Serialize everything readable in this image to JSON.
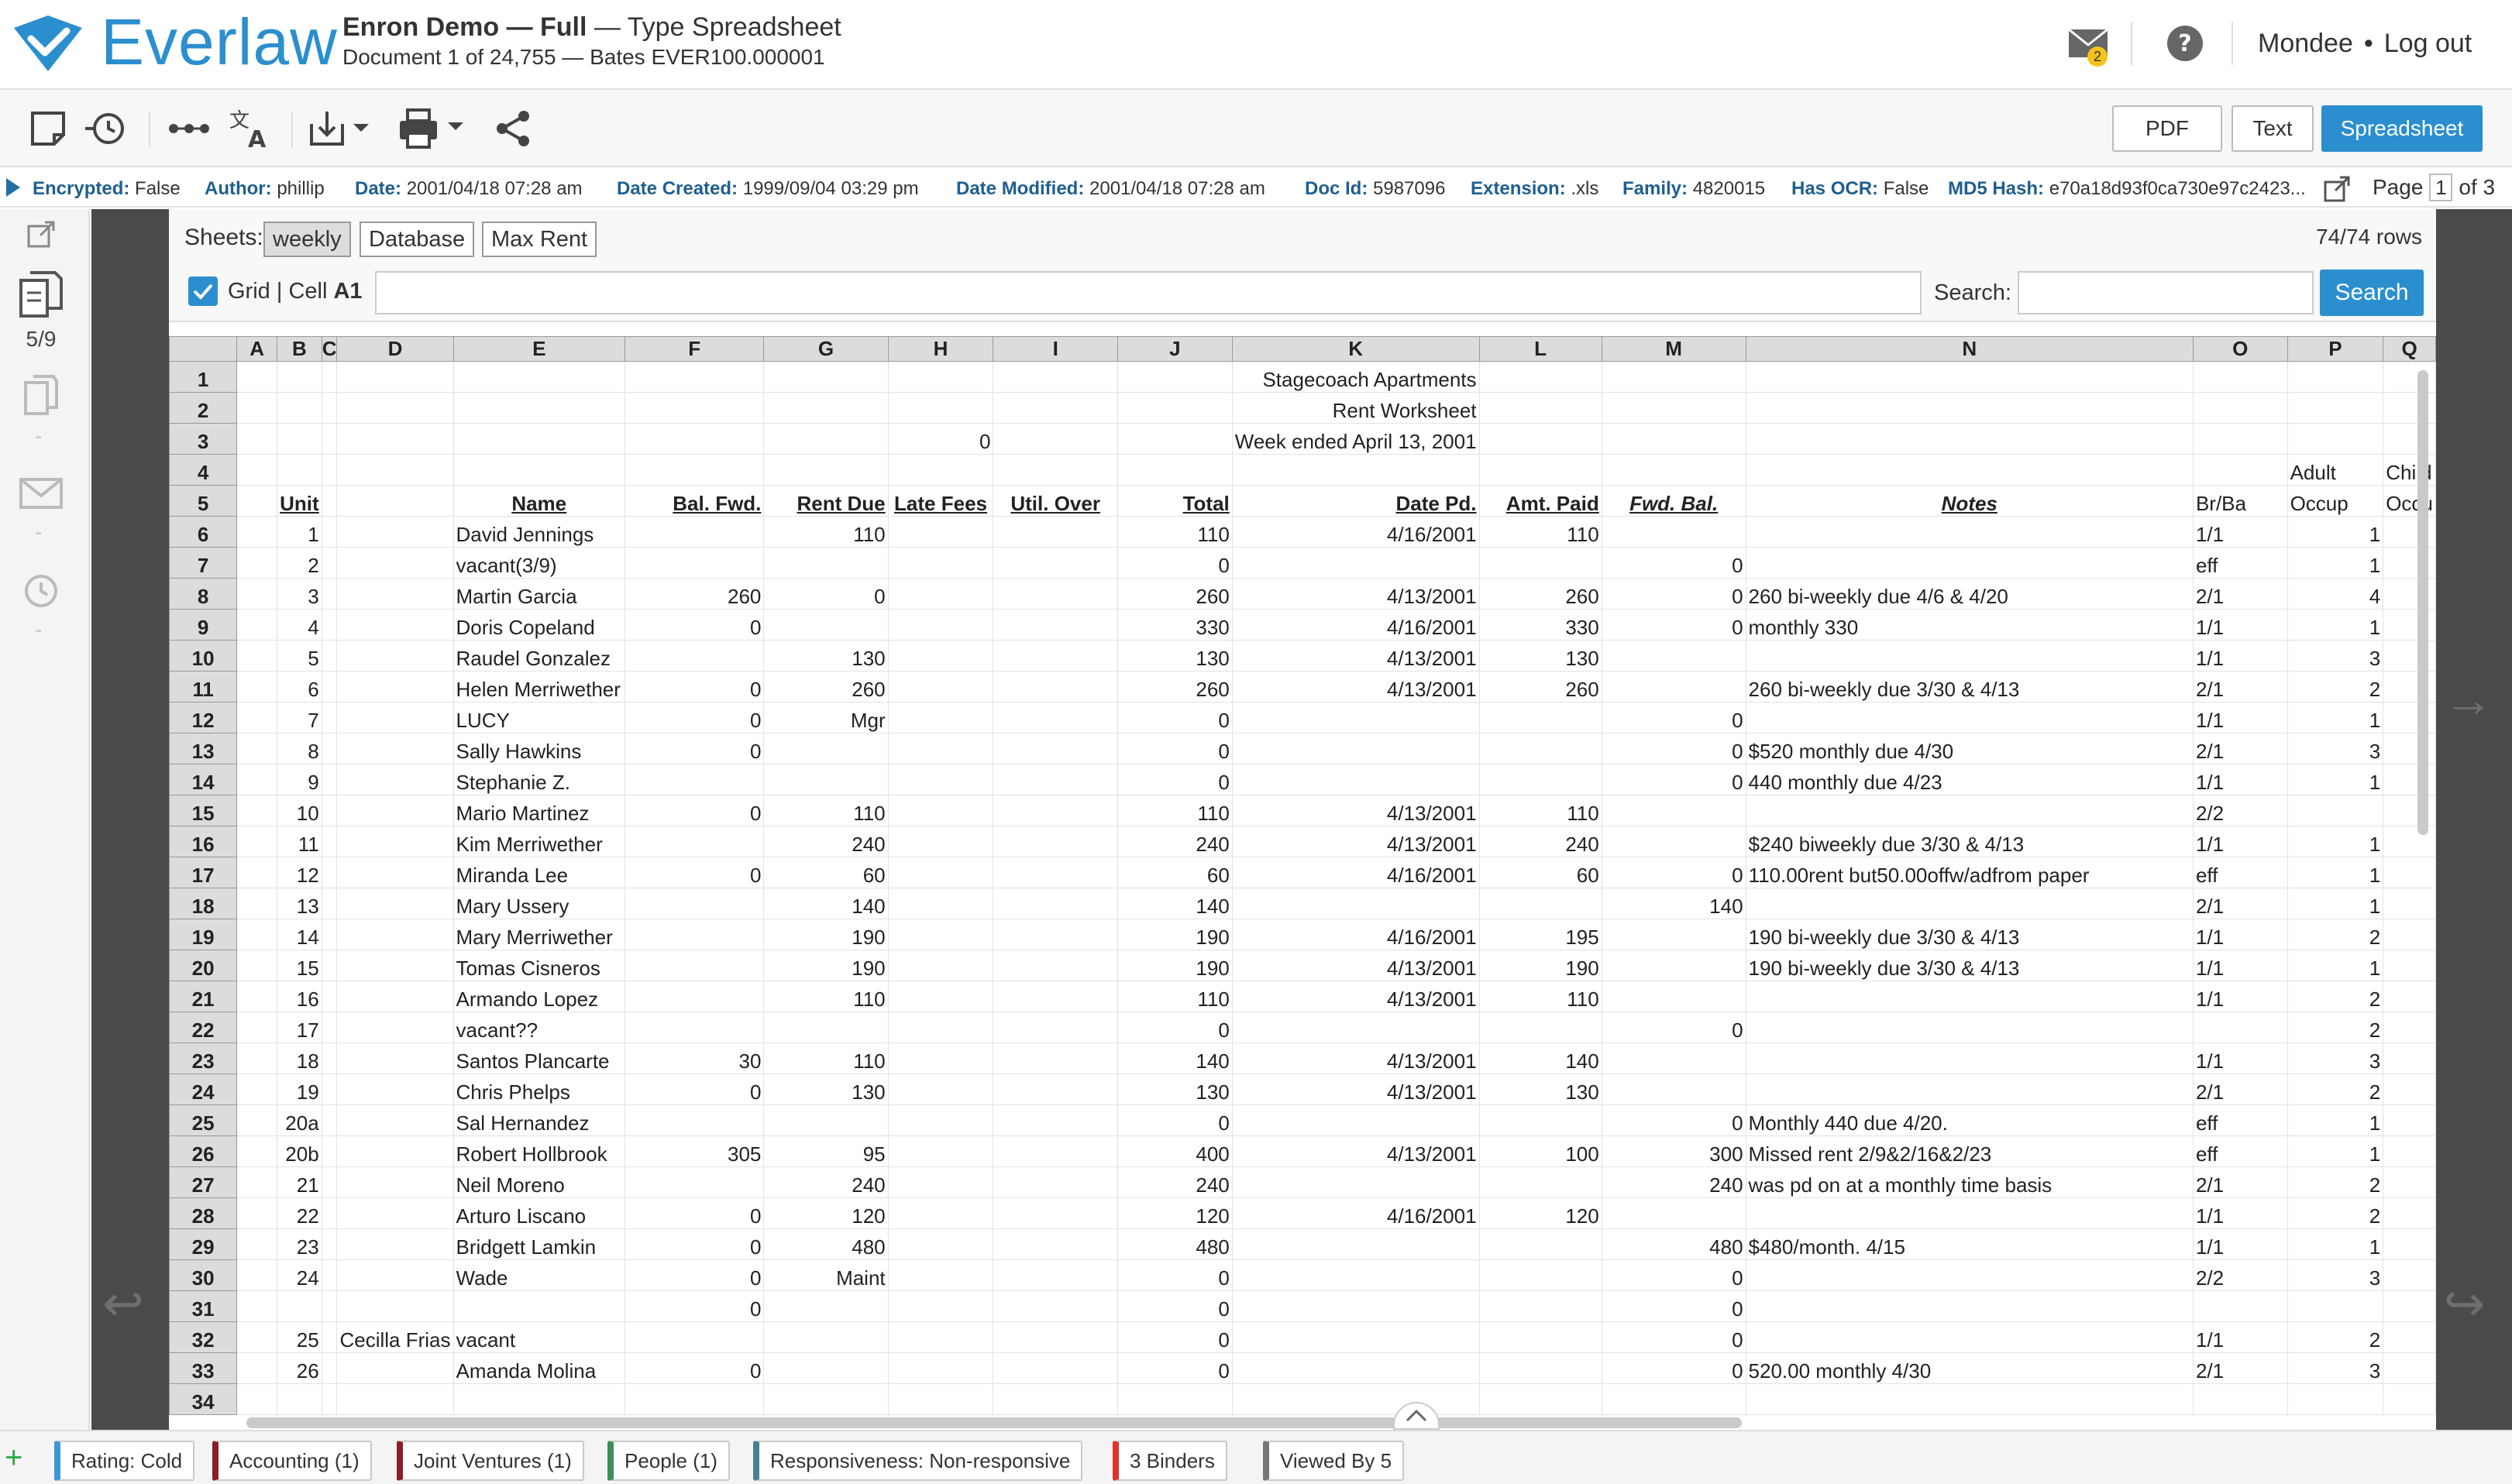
{
  "app": {
    "brand": "Everlaw",
    "project_name": "Enron Demo — Full",
    "type_text": "— Type Spreadsheet",
    "subtitle": "Document 1 of 24,755 — Bates EVER100.000001",
    "mail_badge": "2",
    "user": "Mondee",
    "bullet": "•",
    "logout": "Log out"
  },
  "toolbar": {
    "icons": [
      "note-icon",
      "history-icon",
      "more-icon",
      "translate-icon",
      "download-icon",
      "print-icon",
      "share-icon"
    ],
    "views": {
      "pdf": "PDF",
      "text": "Text",
      "spreadsheet": "Spreadsheet"
    }
  },
  "metadata": [
    {
      "k": "Encrypted:",
      "v": "False"
    },
    {
      "k": "Author:",
      "v": "phillip"
    },
    {
      "k": "Date:",
      "v": "2001/04/18 07:28 am"
    },
    {
      "k": "Date Created:",
      "v": "1999/09/04 03:29 pm"
    },
    {
      "k": "Date Modified:",
      "v": "2001/04/18 07:28 am"
    },
    {
      "k": "Doc Id:",
      "v": "5987096"
    },
    {
      "k": "Extension:",
      "v": ".xls"
    },
    {
      "k": "Family:",
      "v": "4820015"
    },
    {
      "k": "Has OCR:",
      "v": "False"
    },
    {
      "k": "MD5 Hash:",
      "v": "e70a18d93f0ca730e97c2423..."
    }
  ],
  "pager": {
    "label": "Page",
    "current": "1",
    "of": "of 3"
  },
  "rail": {
    "count": "5/9"
  },
  "sheets": {
    "label": "Sheets:",
    "tabs": [
      "weekly",
      "Database",
      "Max Rent"
    ],
    "active": "weekly",
    "row_count": "74/74 rows",
    "grid_label": "Grid",
    "cell_prefix": "Cell",
    "cell_ref": "A1",
    "search_label": "Search:",
    "search_button": "Search"
  },
  "columns": [
    "A",
    "B",
    "C",
    "D",
    "E",
    "F",
    "G",
    "H",
    "I",
    "J",
    "K",
    "L",
    "M",
    "N",
    "O",
    "P",
    "Q"
  ],
  "rows": [
    {
      "n": "1",
      "c": {
        "K": "Stagecoach Apartments"
      }
    },
    {
      "n": "2",
      "c": {
        "K": "Rent Worksheet"
      }
    },
    {
      "n": "3",
      "c": {
        "H": "0",
        "K": "Week ended April 13, 2001"
      }
    },
    {
      "n": "4",
      "c": {
        "P": "Adult",
        "Q": "Child"
      }
    },
    {
      "n": "5",
      "c": {
        "B": "Unit",
        "E": "Name",
        "F": "Bal. Fwd.",
        "G": "Rent Due",
        "H": "Late Fees",
        "I": "Util. Over",
        "J": "Total",
        "K": "Date Pd.",
        "L": "Amt. Paid",
        "M": "Fwd. Bal.",
        "N": "Notes",
        "O": "Br/Ba",
        "P": "Occup",
        "Q": "Occu"
      }
    },
    {
      "n": "6",
      "c": {
        "B": "1",
        "E": "David Jennings",
        "G": "110",
        "J": "110",
        "K": "4/16/2001",
        "L": "110",
        "O": "1/1",
        "P": "1"
      }
    },
    {
      "n": "7",
      "c": {
        "B": "2",
        "E": "vacant(3/9)",
        "J": "0",
        "M": "0",
        "O": "eff",
        "P": "1"
      }
    },
    {
      "n": "8",
      "c": {
        "B": "3",
        "E": "Martin Garcia",
        "F": "260",
        "G": "0",
        "J": "260",
        "K": "4/13/2001",
        "L": "260",
        "M": "0",
        "N": "260 bi-weekly due 4/6 & 4/20",
        "O": "2/1",
        "P": "4"
      }
    },
    {
      "n": "9",
      "c": {
        "B": "4",
        "E": "Doris Copeland",
        "F": "0",
        "J": "330",
        "K": "4/16/2001",
        "L": "330",
        "M": "0",
        "N": "monthly 330",
        "O": "1/1",
        "P": "1"
      }
    },
    {
      "n": "10",
      "c": {
        "B": "5",
        "E": "Raudel Gonzalez",
        "G": "130",
        "J": "130",
        "K": "4/13/2001",
        "L": "130",
        "O": "1/1",
        "P": "3"
      }
    },
    {
      "n": "11",
      "c": {
        "B": "6",
        "E": "Helen Merriwether",
        "F": "0",
        "G": "260",
        "J": "260",
        "K": "4/13/2001",
        "L": "260",
        "N": "260 bi-weekly due 3/30 & 4/13",
        "O": "2/1",
        "P": "2"
      }
    },
    {
      "n": "12",
      "c": {
        "B": "7",
        "E": "LUCY",
        "F": "0",
        "G": "Mgr",
        "J": "0",
        "M": "0",
        "O": "1/1",
        "P": "1"
      }
    },
    {
      "n": "13",
      "c": {
        "B": "8",
        "E": "Sally Hawkins",
        "F": "0",
        "J": "0",
        "M": "0",
        "N": "$520 monthly due 4/30",
        "O": "2/1",
        "P": "3"
      }
    },
    {
      "n": "14",
      "c": {
        "B": "9",
        "E": "Stephanie Z.",
        "J": "0",
        "M": "0",
        "N": "440 monthly due 4/23",
        "O": "1/1",
        "P": "1"
      }
    },
    {
      "n": "15",
      "c": {
        "B": "10",
        "E": "Mario Martinez",
        "F": "0",
        "G": "110",
        "J": "110",
        "K": "4/13/2001",
        "L": "110",
        "O": "2/2"
      }
    },
    {
      "n": "16",
      "c": {
        "B": "11",
        "E": "Kim Merriwether",
        "G": "240",
        "J": "240",
        "K": "4/13/2001",
        "L": "240",
        "N": "$240 biweekly due 3/30 & 4/13",
        "O": "1/1",
        "P": "1"
      }
    },
    {
      "n": "17",
      "c": {
        "B": "12",
        "E": "Miranda Lee",
        "F": "0",
        "G": "60",
        "J": "60",
        "K": "4/16/2001",
        "L": "60",
        "M": "0",
        "N": "110.00rent but50.00offw/adfrom paper",
        "O": "eff",
        "P": "1"
      }
    },
    {
      "n": "18",
      "c": {
        "B": "13",
        "E": "Mary Ussery",
        "G": "140",
        "J": "140",
        "M": "140",
        "O": "2/1",
        "P": "1"
      }
    },
    {
      "n": "19",
      "c": {
        "B": "14",
        "E": "Mary Merriwether",
        "G": "190",
        "J": "190",
        "K": "4/16/2001",
        "L": "195",
        "N": "190 bi-weekly due  3/30 & 4/13",
        "O": "1/1",
        "P": "2"
      }
    },
    {
      "n": "20",
      "c": {
        "B": "15",
        "E": "Tomas Cisneros",
        "G": "190",
        "J": "190",
        "K": "4/13/2001",
        "L": "190",
        "N": "190 bi-weekly due  3/30 & 4/13",
        "O": "1/1",
        "P": "1"
      }
    },
    {
      "n": "21",
      "c": {
        "B": "16",
        "E": "Armando Lopez",
        "G": "110",
        "J": "110",
        "K": "4/13/2001",
        "L": "110",
        "O": "1/1",
        "P": "2"
      }
    },
    {
      "n": "22",
      "c": {
        "B": "17",
        "E": "vacant??",
        "J": "0",
        "M": "0",
        "P": "2"
      }
    },
    {
      "n": "23",
      "c": {
        "B": "18",
        "E": "Santos Plancarte",
        "F": "30",
        "G": "110",
        "J": "140",
        "K": "4/13/2001",
        "L": "140",
        "O": "1/1",
        "P": "3"
      }
    },
    {
      "n": "24",
      "c": {
        "B": "19",
        "E": "Chris Phelps",
        "F": "0",
        "G": "130",
        "J": "130",
        "K": "4/13/2001",
        "L": "130",
        "O": "2/1",
        "P": "2"
      }
    },
    {
      "n": "25",
      "c": {
        "B": "20a",
        "E": "Sal Hernandez",
        "J": "0",
        "M": "0",
        "N": "Monthly 440 due 4/20.",
        "O": "eff",
        "P": "1"
      }
    },
    {
      "n": "26",
      "c": {
        "B": "20b",
        "E": "Robert Hollbrook",
        "F": "305",
        "G": "95",
        "J": "400",
        "K": "4/13/2001",
        "L": "100",
        "M": "300",
        "N": "Missed rent 2/9&2/16&2/23",
        "O": "eff",
        "P": "1"
      }
    },
    {
      "n": "27",
      "c": {
        "B": "21",
        "E": "Neil Moreno",
        "G": "240",
        "J": "240",
        "M": "240",
        "N": "was pd on at a monthly time basis",
        "O": "2/1",
        "P": "2"
      }
    },
    {
      "n": "28",
      "c": {
        "B": "22",
        "E": "Arturo Liscano",
        "F": "0",
        "G": "120",
        "J": "120",
        "K": "4/16/2001",
        "L": "120",
        "O": "1/1",
        "P": "2"
      }
    },
    {
      "n": "29",
      "c": {
        "B": "23",
        "E": "Bridgett Lamkin",
        "F": "0",
        "G": "480",
        "J": "480",
        "M": "480",
        "N": "$480/month. 4/15",
        "O": "1/1",
        "P": "1"
      }
    },
    {
      "n": "30",
      "c": {
        "B": "24",
        "E": "Wade",
        "F": "0",
        "G": "Maint",
        "J": "0",
        "M": "0",
        "O": "2/2",
        "P": "3"
      }
    },
    {
      "n": "31",
      "c": {
        "F": "0",
        "J": "0",
        "M": "0"
      }
    },
    {
      "n": "32",
      "c": {
        "B": "25",
        "D": "Cecilla Frias",
        "E": "vacant",
        "J": "0",
        "M": "0",
        "O": "1/1",
        "P": "2"
      }
    },
    {
      "n": "33",
      "c": {
        "B": "26",
        "E": "Amanda Molina",
        "F": "0",
        "J": "0",
        "M": "0",
        "N": "520.00 monthly 4/30",
        "O": "2/1",
        "P": "3"
      }
    },
    {
      "n": "34",
      "c": {}
    }
  ],
  "tags": [
    {
      "label": "Rating: Cold",
      "color": "#3a97d4"
    },
    {
      "label": "Accounting (1)",
      "color": "#8b1c2a"
    },
    {
      "label": "Joint Ventures (1)",
      "color": "#8b1c2a"
    },
    {
      "label": "People (1)",
      "color": "#3e8f5a"
    },
    {
      "label": "Responsiveness: Non-responsive",
      "color": "#4a7f95"
    },
    {
      "label": "3 Binders",
      "color": "#e0312b"
    },
    {
      "label": "Viewed By 5",
      "color": "#777777"
    }
  ]
}
